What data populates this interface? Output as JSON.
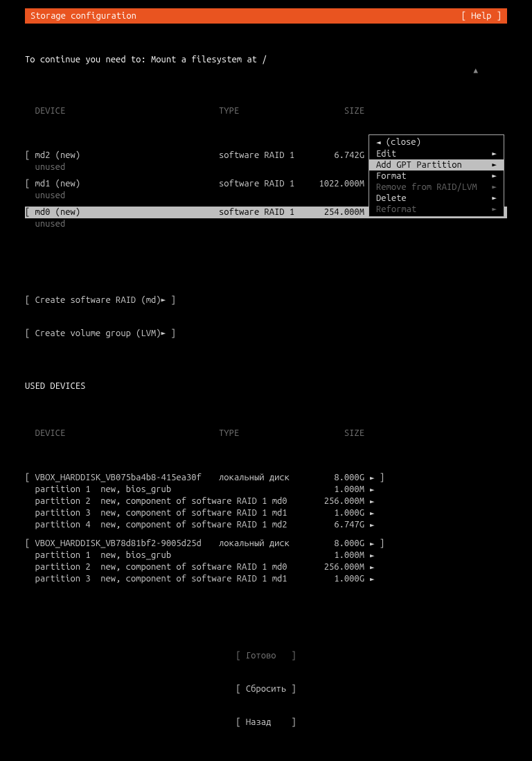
{
  "titlebar": {
    "title": "Storage configuration",
    "help": "[ Help ]"
  },
  "hint": "To continue you need to: Mount a filesystem at /",
  "columns": {
    "device": "DEVICE",
    "type": "TYPE",
    "size": "SIZE"
  },
  "avail": [
    {
      "name": "md2 (new)",
      "type": "software RAID 1",
      "size": "6.742G",
      "sub": "unused",
      "selected": false
    },
    {
      "name": "md1 (new)",
      "type": "software RAID 1",
      "size": "1022.000M",
      "sub": "unused",
      "selected": false
    },
    {
      "name": "md0 (new)",
      "type": "software RAID 1",
      "size": "254.000M",
      "sub": "unused",
      "selected": true
    }
  ],
  "create": {
    "raid": "Create software RAID (md)",
    "lvm": "Create volume group (LVM)"
  },
  "used_title": "USED DEVICES",
  "used": [
    {
      "name": "VBOX_HARDDISK_VB075ba4b8-415ea30f",
      "type": "локальный диск",
      "size": "8.000G",
      "parts": [
        {
          "name": "partition 1",
          "desc": "new, bios_grub",
          "size": "1.000M"
        },
        {
          "name": "partition 2",
          "desc": "new, component of software RAID 1 md0",
          "size": "256.000M"
        },
        {
          "name": "partition 3",
          "desc": "new, component of software RAID 1 md1",
          "size": "1.000G"
        },
        {
          "name": "partition 4",
          "desc": "new, component of software RAID 1 md2",
          "size": "6.747G"
        }
      ]
    },
    {
      "name": "VBOX_HARDDISK_VB78d81bf2-9005d25d",
      "type": "локальный диск",
      "size": "8.000G",
      "parts": [
        {
          "name": "partition 1",
          "desc": "new, bios_grub",
          "size": "1.000M"
        },
        {
          "name": "partition 2",
          "desc": "new, component of software RAID 1 md0",
          "size": "256.000M"
        },
        {
          "name": "partition 3",
          "desc": "new, component of software RAID 1 md1",
          "size": "1.000G"
        }
      ]
    }
  ],
  "menu": {
    "close": "(close)",
    "items": [
      {
        "label": "Edit",
        "enabled": true,
        "selected": false
      },
      {
        "label": "Add GPT Partition",
        "enabled": true,
        "selected": true
      },
      {
        "label": "Format",
        "enabled": true,
        "selected": false
      },
      {
        "label": "Remove from RAID/LVM",
        "enabled": false,
        "selected": false
      },
      {
        "label": "Delete",
        "enabled": true,
        "selected": false
      },
      {
        "label": "Reformat",
        "enabled": false,
        "selected": false
      }
    ]
  },
  "buttons": {
    "done": "Готово",
    "reset": "Сбросить",
    "back": "Назад"
  },
  "glyph": {
    "tri_r": "►",
    "tri_l": "◄"
  }
}
